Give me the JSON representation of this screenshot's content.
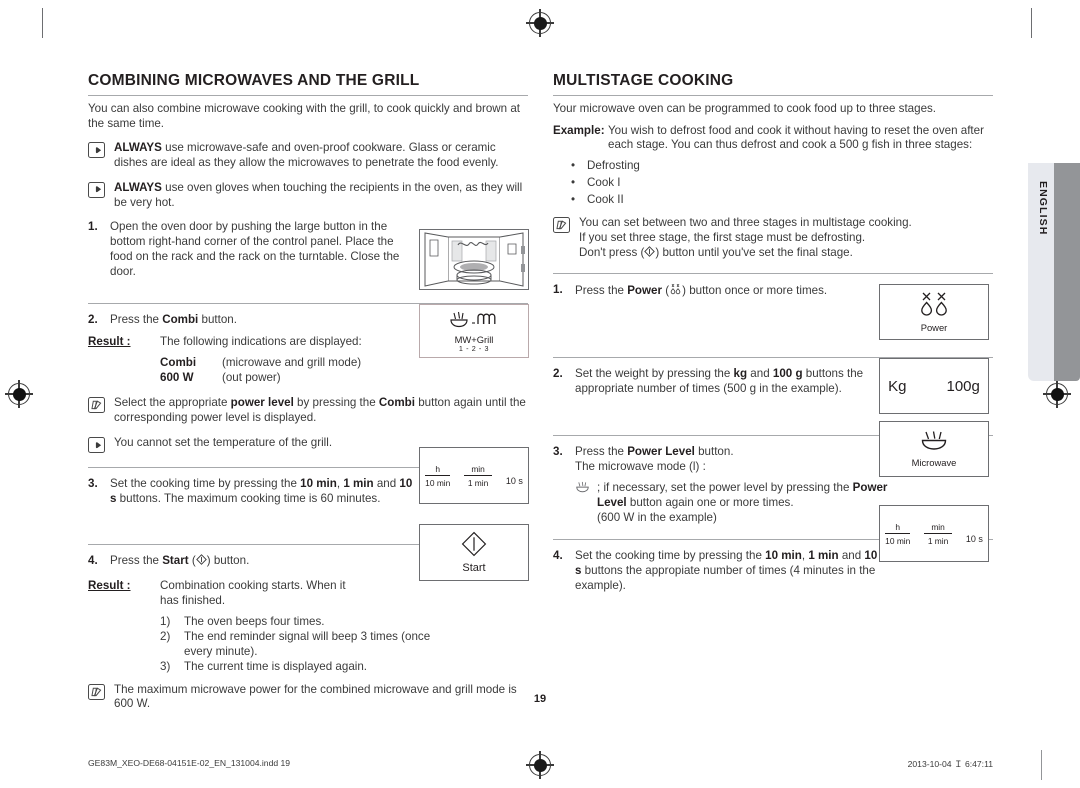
{
  "marks": {
    "registration_icon": "registration-target-icon"
  },
  "language_tab": {
    "label": "ENGLISH"
  },
  "left_column": {
    "heading": "COMBINING MICROWAVES AND THE GRILL",
    "intro": "You can also combine microwave cooking with the grill, to cook quickly and brown at the same time.",
    "notes": [
      {
        "icon": "hand-pointer-icon",
        "bold": "ALWAYS",
        "text": " use microwave-safe and oven-proof cookware. Glass or ceramic dishes are ideal as they allow the microwaves to penetrate the food evenly."
      },
      {
        "icon": "hand-pointer-icon",
        "bold": "ALWAYS",
        "text": " use oven gloves when touching the recipients in the oven, as they will be very hot."
      }
    ],
    "step1": {
      "num": "1.",
      "text": "Open the oven door by pushing the large button in the bottom right-hand corner of the control panel. Place the food on the rack and the rack on the turntable. Close the door.",
      "figure": "oven-door-open-illustration"
    },
    "step2": {
      "num": "2.",
      "text_before": "Press the ",
      "bold": "Combi",
      "text_after": " button.",
      "result_label": "Result :",
      "result_text": "The following indications are displayed:",
      "display_rows": [
        {
          "key": "Combi",
          "value": "(microwave and grill mode)"
        },
        {
          "key": "600 W",
          "value": "(out power)"
        }
      ],
      "keybox": {
        "icon": "mw-plus-grill-icon",
        "caption": "MW+Grill",
        "sub": "1 - 2 - 3"
      }
    },
    "note_power_level": {
      "icon": "note-pencil-icon",
      "text_a": "Select the appropriate ",
      "bold_a": "power level",
      "text_b": " by pressing the ",
      "bold_b": "Combi",
      "text_c": " button again until the corresponding power level is displayed."
    },
    "note_grill_temp": {
      "icon": "hand-pointer-icon",
      "text": "You cannot set the temperature of the grill."
    },
    "step3": {
      "num": "3.",
      "text_a": "Set the cooking time by pressing the ",
      "bold_a": "10 min",
      "text_b": ", ",
      "bold_b": "1 min",
      "text_c": " and ",
      "bold_c": "10 s",
      "text_d": " buttons. The maximum cooking time is 60 minutes.",
      "keybox": {
        "cells": [
          {
            "top": "h",
            "bottom": "10 min"
          },
          {
            "top": "min",
            "bottom": "1 min"
          }
        ],
        "plain": "10 s"
      }
    },
    "step4": {
      "num": "4.",
      "text_before": "Press the ",
      "bold": "Start",
      "icon": "start-diamond-icon",
      "text_after": " button.",
      "result_label": "Result :",
      "result_text": "Combination cooking starts. When it has finished.",
      "items": [
        {
          "mark": "1)",
          "text": "The oven beeps four times."
        },
        {
          "mark": "2)",
          "text": "The end reminder signal will beep 3 times (once every minute)."
        },
        {
          "mark": "3)",
          "text": "The current time is displayed again."
        }
      ],
      "keybox": {
        "icon": "start-diamond-icon",
        "caption": "Start"
      }
    },
    "note_max_power": {
      "icon": "note-pencil-icon",
      "text": "The maximum microwave power for the combined microwave and grill mode is 600 W."
    }
  },
  "right_column": {
    "heading": "MULTISTAGE COOKING",
    "intro": "Your microwave oven can be programmed to cook food up to three stages.",
    "example": {
      "label": "Example:",
      "text": "You wish to defrost food and cook it without having to reset the oven after each stage. You can thus defrost and cook a 500 g fish in three stages:"
    },
    "stages": [
      "Defrosting",
      "Cook I",
      "Cook II"
    ],
    "note_stages": {
      "icon": "note-pencil-icon",
      "line1": "You can set between two and three stages in multistage cooking.",
      "line2": "If you set three stage, the first stage must be defrosting.",
      "line3_a": "Don't press (",
      "line3_icon": "start-diamond-icon",
      "line3_b": ") button until you've set the final stage."
    },
    "step1": {
      "num": "1.",
      "text_before": "Press the ",
      "bold": "Power",
      "icon": "power-droplets-icon",
      "text_after": " button once or more times.",
      "keybox": {
        "icon": "power-droplets-icon",
        "caption": "Power"
      }
    },
    "step2": {
      "num": "2.",
      "text_a": "Set the weight by pressing the ",
      "bold_a": "kg",
      "text_b": " and ",
      "bold_b": "100 g",
      "text_c": " buttons the appropriate number of times (500 g in the example).",
      "keybox": {
        "left": "Kg",
        "right": "100g"
      }
    },
    "step3": {
      "num": "3.",
      "text_before": "Press the ",
      "bold": "Power Level",
      "text_after": " button.",
      "line2": "The microwave mode (l) :",
      "sub": {
        "icon": "microwave-waves-icon",
        "text_a": ";   if necessary, set the power level by pressing the ",
        "bold_a": "Power Level",
        "text_b": " button again one or more times.",
        "line3": "(600 W in the example)"
      },
      "keybox": {
        "icon": "microwave-waves-icon",
        "caption": "Microwave"
      }
    },
    "step4": {
      "num": "4.",
      "text_a": "Set the cooking time by pressing the ",
      "bold_a": "10 min",
      "text_b": ", ",
      "bold_b": "1 min",
      "text_c": " and ",
      "bold_c": "10 s",
      "text_d": " buttons the appropiate number of times (4 minutes in the example).",
      "keybox": {
        "cells": [
          {
            "top": "h",
            "bottom": "10 min"
          },
          {
            "top": "min",
            "bottom": "1 min"
          }
        ],
        "plain": "10 s"
      }
    }
  },
  "footer": {
    "page_number": "19",
    "file_name": "GE83M_XEO-DE68-04151E-02_EN_131004.indd   19",
    "timestamp": "2013-10-04   Ｉ 6:47:11"
  },
  "colors": {
    "text": "#231f20",
    "body_text": "#3b3b3b",
    "rule": "#a7a9ac",
    "keybox_border": "#b9a9ab",
    "lang_tab_light": "#e7e9ee",
    "lang_tab_dark": "#939598"
  }
}
